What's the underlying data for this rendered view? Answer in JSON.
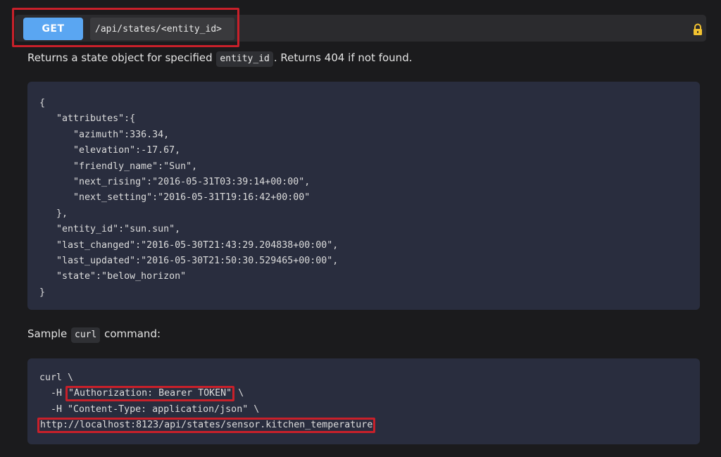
{
  "endpoint": {
    "method": "GET",
    "path": "/api/states/<entity_id>",
    "lock_icon": "lock-icon",
    "method_color": "#5aa6f2",
    "highlight_color": "#c8202a"
  },
  "description": {
    "before": "Returns a state object for specified ",
    "code": "entity_id",
    "after": ". Returns 404 if not found."
  },
  "json_lines": [
    "{",
    "   \"attributes\":{",
    "      \"azimuth\":336.34,",
    "      \"elevation\":-17.67,",
    "      \"friendly_name\":\"Sun\",",
    "      \"next_rising\":\"2016-05-31T03:39:14+00:00\",",
    "      \"next_setting\":\"2016-05-31T19:16:42+00:00\"",
    "   },",
    "   \"entity_id\":\"sun.sun\",",
    "   \"last_changed\":\"2016-05-30T21:43:29.204838+00:00\",",
    "   \"last_updated\":\"2016-05-30T21:50:30.529465+00:00\",",
    "   \"state\":\"below_horizon\"",
    "}"
  ],
  "sample": {
    "before": "Sample ",
    "code": "curl",
    "after": " command:"
  },
  "curl": {
    "line1": "curl \\",
    "line2_prefix": "  -H ",
    "line2_highlight": "\"Authorization: Bearer TOKEN\"",
    "line2_suffix": " \\",
    "line3": "  -H \"Content-Type: application/json\" \\",
    "line4_highlight": "http://localhost:8123/api/states/sensor.kitchen_temperature"
  }
}
